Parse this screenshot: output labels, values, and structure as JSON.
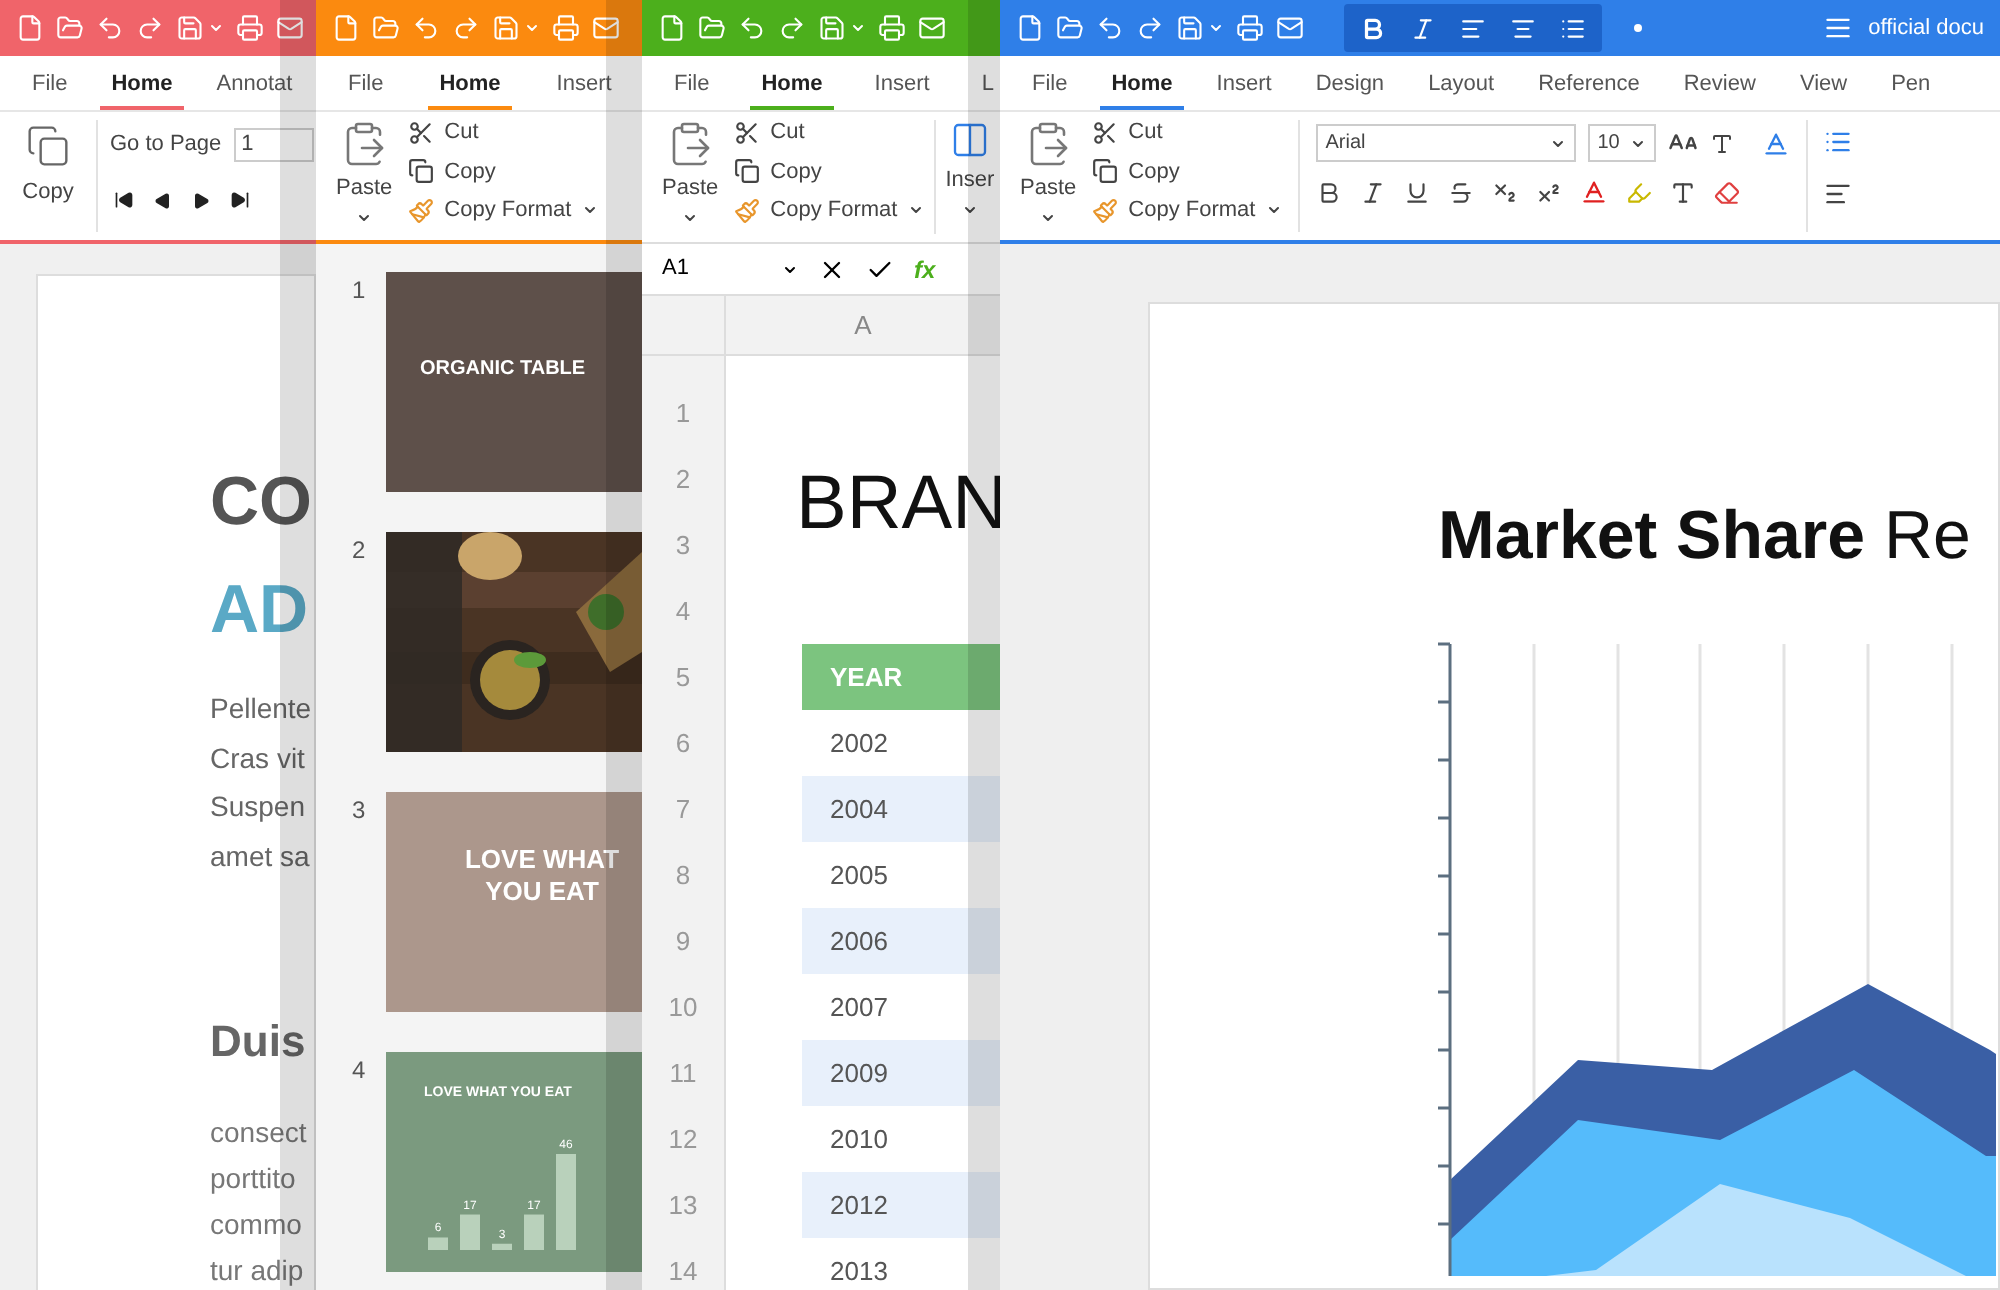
{
  "pdf_window": {
    "tabs": [
      {
        "label": "File",
        "selected": false
      },
      {
        "label": "Home",
        "selected": true
      },
      {
        "label": "Annotat",
        "selected": false
      }
    ],
    "copy_button": "Copy",
    "go_to_page_label": "Go to Page",
    "page_number": "1",
    "page": {
      "heading_lines": [
        "CO",
        "AD"
      ],
      "body_lines": [
        "Pellente",
        "Cras vit",
        "Suspen",
        "amet sa"
      ],
      "subheading": "Duis",
      "body_lines_2": [
        "consect",
        "porttito",
        "commo",
        "tur adip"
      ]
    }
  },
  "presentation_window": {
    "tabs": [
      {
        "label": "File",
        "selected": false
      },
      {
        "label": "Home",
        "selected": true
      },
      {
        "label": "Insert",
        "selected": false
      }
    ],
    "clipboard": {
      "paste": "Paste",
      "cut": "Cut",
      "copy": "Copy",
      "copy_format": "Copy Format"
    },
    "slides": [
      {
        "number": "1",
        "kind": "title",
        "title": "ORGANIC TABLE"
      },
      {
        "number": "2",
        "kind": "picture"
      },
      {
        "number": "3",
        "kind": "quote",
        "title": "LOVE WHAT YOU EAT"
      },
      {
        "number": "4",
        "kind": "chart",
        "title": "LOVE WHAT YOU EAT",
        "bar_labels": [
          "6",
          "17",
          "3",
          "17",
          "46"
        ]
      }
    ]
  },
  "spreadsheet_window": {
    "tabs": [
      {
        "label": "File",
        "selected": false
      },
      {
        "label": "Home",
        "selected": true
      },
      {
        "label": "Insert",
        "selected": false
      },
      {
        "label": "L",
        "selected": false
      }
    ],
    "clipboard": {
      "paste": "Paste",
      "cut": "Cut",
      "copy": "Copy",
      "copy_format": "Copy Format"
    },
    "insert_button": "Inser",
    "cell_reference": "A1",
    "formula_label": "fx",
    "column_header": "A",
    "row_numbers": [
      "1",
      "2",
      "3",
      "4",
      "5",
      "6",
      "7",
      "8",
      "9",
      "10",
      "11",
      "12",
      "13",
      "14"
    ],
    "sheet_title": "BRAN",
    "table_header": "YEAR",
    "years": [
      "2002",
      "2004",
      "2005",
      "2006",
      "2007",
      "2009",
      "2010",
      "2012",
      "2013"
    ]
  },
  "document_window": {
    "title": "official docu",
    "tabs": [
      {
        "label": "File",
        "selected": false
      },
      {
        "label": "Home",
        "selected": true
      },
      {
        "label": "Insert",
        "selected": false
      },
      {
        "label": "Design",
        "selected": false
      },
      {
        "label": "Layout",
        "selected": false
      },
      {
        "label": "Reference",
        "selected": false
      },
      {
        "label": "Review",
        "selected": false
      },
      {
        "label": "View",
        "selected": false
      },
      {
        "label": "Pen",
        "selected": false
      }
    ],
    "clipboard": {
      "paste": "Paste",
      "cut": "Cut",
      "copy": "Copy",
      "copy_format": "Copy Format"
    },
    "font_name": "Arial",
    "font_size": "10",
    "page_title": "**Market Share** Re"
  }
}
